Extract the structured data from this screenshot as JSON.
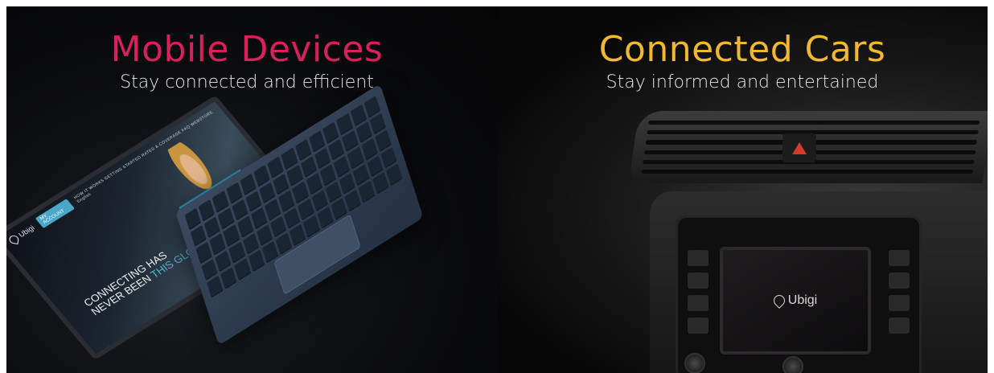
{
  "sections": {
    "mobile": {
      "title": "Mobile Devices",
      "subtitle": "Stay connected and efficient",
      "title_color": "#d91f5c"
    },
    "cars": {
      "title": "Connected Cars",
      "subtitle": "Stay informed and entertained",
      "title_color": "#f2b82f"
    }
  },
  "laptop_screen": {
    "brand": "Ubigi",
    "cta": "MY ACCOUNT",
    "nav": "HOW IT WORKS   GETTING STARTED   RATES & COVERAGE   FAQ   WEBSTORE   English",
    "headline_line1": "CONNECTING HAS",
    "headline_line2_a": "NEVER BEEN ",
    "headline_line2_b": "THIS GLOBAL",
    "accent_color": "#4fb6d8"
  },
  "car_screen": {
    "brand": "Ubigi",
    "hazard_color": "#d33b2b"
  },
  "icons": [
    "location-pin-icon",
    "hazard-warning-icon",
    "carousel-left-arrow-icon"
  ]
}
